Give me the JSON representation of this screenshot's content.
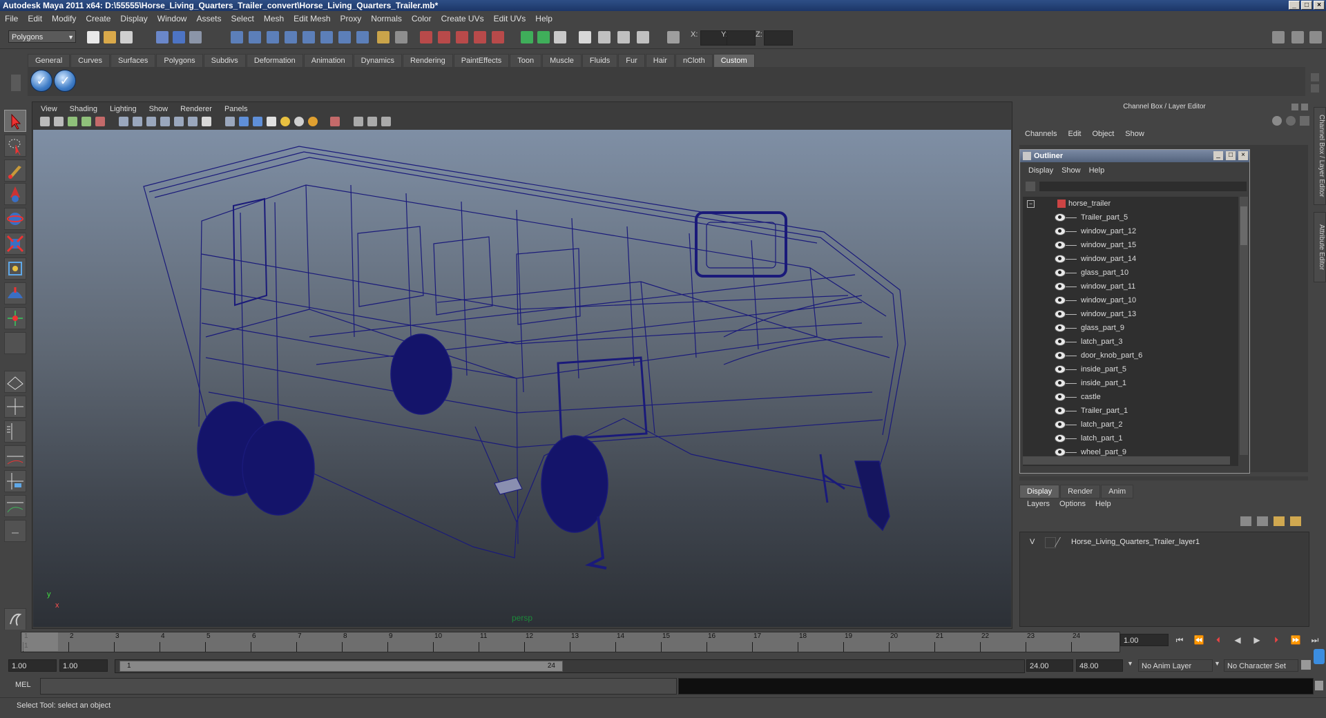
{
  "window": {
    "title": "Autodesk Maya 2011 x64: D:\\55555\\Horse_Living_Quarters_Trailer_convert\\Horse_Living_Quarters_Trailer.mb*",
    "buttons": [
      "minimize",
      "maximize",
      "close"
    ]
  },
  "menubar": [
    "File",
    "Edit",
    "Modify",
    "Create",
    "Display",
    "Window",
    "Assets",
    "Select",
    "Mesh",
    "Edit Mesh",
    "Proxy",
    "Normals",
    "Color",
    "Create UVs",
    "Edit UVs",
    "Help"
  ],
  "toolbar": {
    "mode": "Polygons",
    "x_label": "X:",
    "y_label": "Y:",
    "z_label": "Z:"
  },
  "shelf": {
    "tabs": [
      "General",
      "Curves",
      "Surfaces",
      "Polygons",
      "Subdivs",
      "Deformation",
      "Animation",
      "Dynamics",
      "Rendering",
      "PaintEffects",
      "Toon",
      "Muscle",
      "Fluids",
      "Fur",
      "Hair",
      "nCloth",
      "Custom"
    ],
    "active_tab": "Custom"
  },
  "viewport": {
    "menu": [
      "View",
      "Shading",
      "Lighting",
      "Show",
      "Renderer",
      "Panels"
    ],
    "camera_label": "persp",
    "axis_y": "y",
    "axis_x": "x",
    "wire_color": "#1a1a7a"
  },
  "channelbox": {
    "title": "Channel Box / Layer Editor",
    "menu": [
      "Channels",
      "Edit",
      "Object",
      "Show"
    ]
  },
  "outliner": {
    "title": "Outliner",
    "menu": [
      "Display",
      "Show",
      "Help"
    ],
    "root": "horse_trailer",
    "items": [
      "Trailer_part_5",
      "window_part_12",
      "window_part_15",
      "window_part_14",
      "glass_part_10",
      "window_part_11",
      "window_part_10",
      "window_part_13",
      "glass_part_9",
      "latch_part_3",
      "door_knob_part_6",
      "inside_part_5",
      "inside_part_1",
      "castle",
      "Trailer_part_1",
      "latch_part_2",
      "latch_part_1",
      "wheel_part_9"
    ]
  },
  "layers": {
    "tabs": [
      "Display",
      "Render",
      "Anim"
    ],
    "active_tab": "Display",
    "menu": [
      "Layers",
      "Options",
      "Help"
    ],
    "rows": [
      {
        "visibility": "V",
        "name": "Horse_Living_Quarters_Trailer_layer1"
      }
    ]
  },
  "side_tabs": [
    "Channel Box / Layer Editor",
    "Attribute Editor"
  ],
  "timeline": {
    "ticks": [
      "1",
      "2",
      "3",
      "4",
      "5",
      "6",
      "7",
      "8",
      "9",
      "10",
      "11",
      "12",
      "13",
      "14",
      "15",
      "16",
      "17",
      "18",
      "19",
      "20",
      "21",
      "22",
      "23",
      "24"
    ],
    "current_marker": "1",
    "current_frame": "1.00"
  },
  "range": {
    "start": "1.00",
    "playback_start": "1.00",
    "slider_start": "1",
    "slider_end": "24",
    "playback_end": "24.00",
    "end": "48.00",
    "anim_layer": "No Anim Layer",
    "character_set": "No Character Set"
  },
  "command_line": {
    "label": "MEL"
  },
  "status": "Select Tool: select an object"
}
